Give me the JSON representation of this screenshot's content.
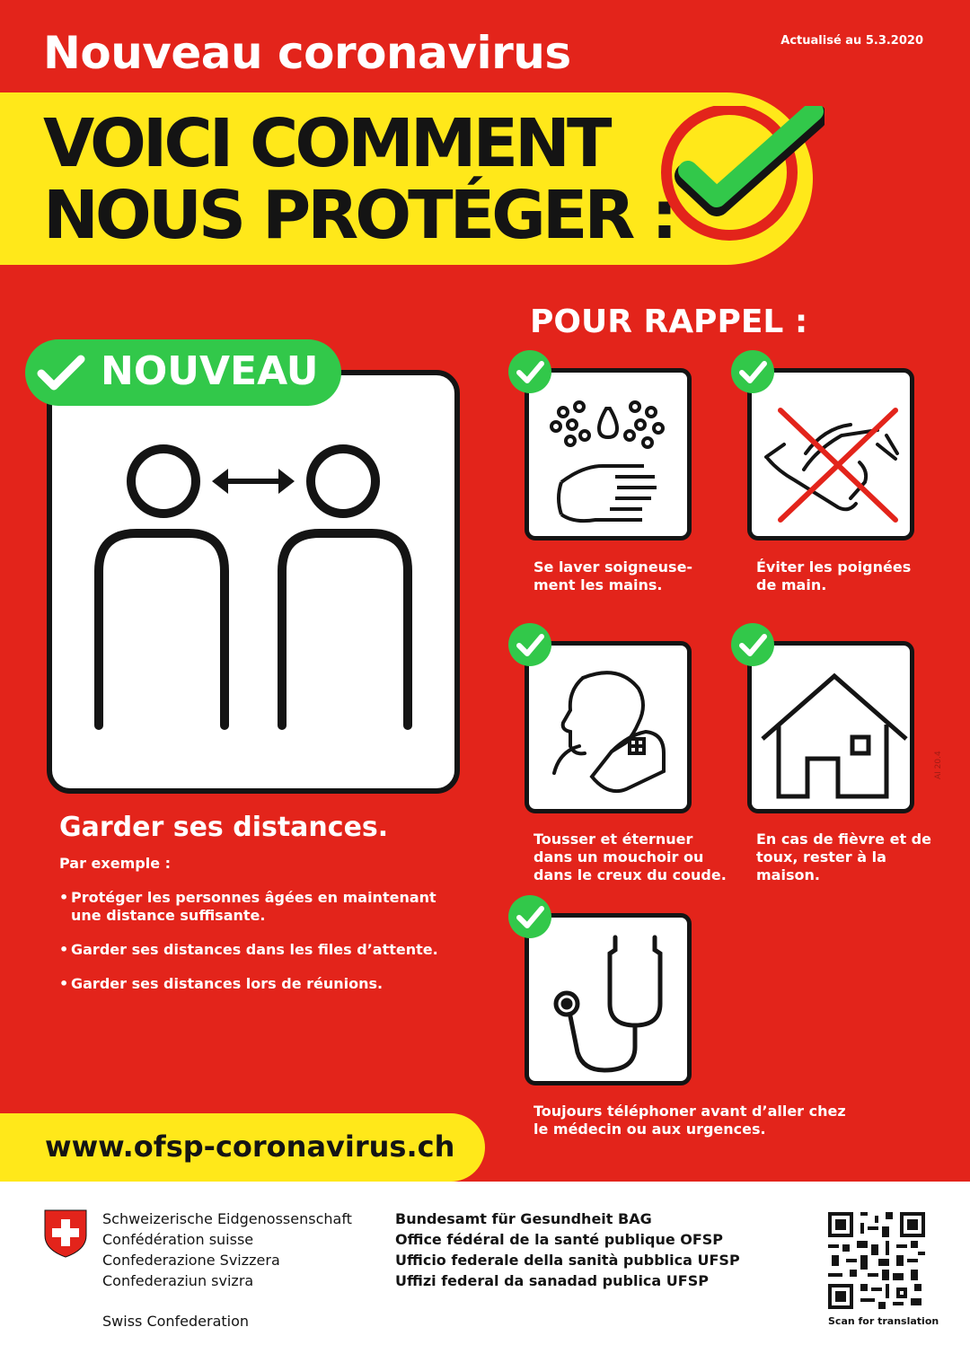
{
  "header": {
    "title": "Nouveau coronavirus",
    "updated": "Actualisé au 5.3.2020",
    "headline_line1": "VOICI COMMENT",
    "headline_line2": "NOUS PROTÉGER :"
  },
  "new_measure": {
    "badge": "NOUVEAU",
    "title": "Garder ses distances.",
    "example_label": "Par exemple :",
    "examples": [
      "Protéger les personnes âgées en maintenant une distance suffisante.",
      "Garder ses distances dans les files d’attente.",
      "Garder ses distances lors de réunions."
    ],
    "icon": "two-people-distance-icon"
  },
  "reminder": {
    "title": "POUR RAPPEL :",
    "items": [
      {
        "icon": "hand-washing-icon",
        "caption": "Se laver soigneuse-ment les mains."
      },
      {
        "icon": "no-handshake-icon",
        "caption": "Éviter les poignées de main."
      },
      {
        "icon": "cough-into-elbow-icon",
        "caption": "Tousser et éternuer dans un mouchoir ou dans le creux du coude."
      },
      {
        "icon": "stay-home-icon",
        "caption": "En cas de fièvre et de toux, rester à la maison."
      },
      {
        "icon": "stethoscope-icon",
        "caption": "Toujours téléphoner avant d’aller chez le médecin ou aux urgences."
      }
    ]
  },
  "website": "www.ofsp-coronavirus.ch",
  "side_code": "AI 20.4",
  "footer": {
    "confederation": [
      "Schweizerische Eidgenossenschaft",
      "Confédération suisse",
      "Confederazione Svizzera",
      "Confederaziun svizra"
    ],
    "swiss_confederation": "Swiss Confederation",
    "office": [
      "Bundesamt für Gesundheit BAG",
      "Office fédéral de la santé publique OFSP",
      "Ufficio federale della sanità pubblica UFSP",
      "Uffizi federal da sanadad publica UFSP"
    ],
    "qr_caption": "Scan for translation"
  },
  "colors": {
    "background_red": "#e3241b",
    "accent_yellow": "#ffe81a",
    "check_green": "#32c84a",
    "ink": "#141414"
  }
}
